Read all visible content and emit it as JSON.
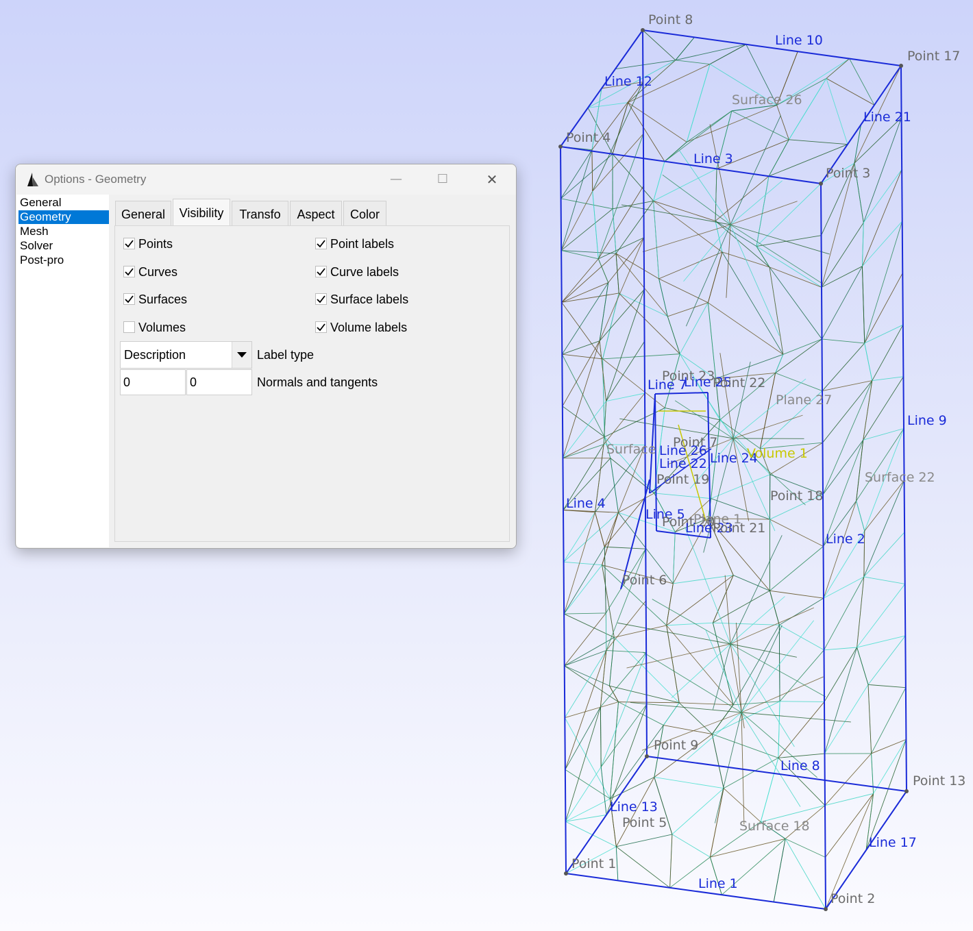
{
  "window": {
    "title": "Options - Geometry",
    "minimize": "—",
    "maximize": "☐",
    "close": "✕"
  },
  "sidebar": {
    "items": [
      {
        "label": "General",
        "selected": false
      },
      {
        "label": "Geometry",
        "selected": true
      },
      {
        "label": "Mesh",
        "selected": false
      },
      {
        "label": "Solver",
        "selected": false
      },
      {
        "label": "Post-pro",
        "selected": false
      }
    ]
  },
  "tabs": [
    {
      "label": "General",
      "active": false
    },
    {
      "label": "Visibility",
      "active": true
    },
    {
      "label": "Transfo",
      "active": false
    },
    {
      "label": "Aspect",
      "active": false
    },
    {
      "label": "Color",
      "active": false
    }
  ],
  "visibility": {
    "checkboxes": [
      {
        "label": "Points",
        "checked": true
      },
      {
        "label": "Point labels",
        "checked": true
      },
      {
        "label": "Curves",
        "checked": true
      },
      {
        "label": "Curve labels",
        "checked": true
      },
      {
        "label": "Surfaces",
        "checked": true
      },
      {
        "label": "Surface labels",
        "checked": true
      },
      {
        "label": "Volumes",
        "checked": false
      },
      {
        "label": "Volume labels",
        "checked": true
      }
    ],
    "label_type": {
      "value": "Description",
      "label": "Label type"
    },
    "normals": {
      "value1": "0",
      "value2": "0",
      "label": "Normals and tangents"
    }
  },
  "scene": {
    "colors": {
      "line": "#1a2bd8",
      "point": "#6b6b6b",
      "surface": "#8a8a8a",
      "volume": "#c8c800"
    },
    "labels": [
      {
        "text": "Point 8",
        "kind": "point"
      },
      {
        "text": "Line 10",
        "kind": "line"
      },
      {
        "text": "Point 17",
        "kind": "point"
      },
      {
        "text": "Line 12",
        "kind": "line"
      },
      {
        "text": "Surface 26",
        "kind": "surface"
      },
      {
        "text": "Line 21",
        "kind": "line"
      },
      {
        "text": "Point 4",
        "kind": "point"
      },
      {
        "text": "Line 3",
        "kind": "line"
      },
      {
        "text": "Point 3",
        "kind": "point"
      },
      {
        "text": "Point 23",
        "kind": "point"
      },
      {
        "text": "Line 7",
        "kind": "line"
      },
      {
        "text": "Line 25",
        "kind": "line"
      },
      {
        "text": "Point 22",
        "kind": "point"
      },
      {
        "text": "Plane 27",
        "kind": "surface"
      },
      {
        "text": "Line 9",
        "kind": "line"
      },
      {
        "text": "Point 7",
        "kind": "point"
      },
      {
        "text": "Surface",
        "kind": "surface"
      },
      {
        "text": "Line 26",
        "kind": "line"
      },
      {
        "text": "Line 24",
        "kind": "line"
      },
      {
        "text": "Volume 1",
        "kind": "volume"
      },
      {
        "text": "Line 22",
        "kind": "line"
      },
      {
        "text": "Point 19",
        "kind": "point"
      },
      {
        "text": "Surface 22",
        "kind": "surface"
      },
      {
        "text": "Point 18",
        "kind": "point"
      },
      {
        "text": "Line 4",
        "kind": "line"
      },
      {
        "text": "Line 5",
        "kind": "line"
      },
      {
        "text": "Point 20",
        "kind": "point"
      },
      {
        "text": "Plane 1",
        "kind": "surface"
      },
      {
        "text": "Line 23",
        "kind": "line"
      },
      {
        "text": "Point 21",
        "kind": "point"
      },
      {
        "text": "Line 2",
        "kind": "line"
      },
      {
        "text": "Point 6",
        "kind": "point"
      },
      {
        "text": "Point 9",
        "kind": "point"
      },
      {
        "text": "Line 8",
        "kind": "line"
      },
      {
        "text": "Point 13",
        "kind": "point"
      },
      {
        "text": "Line 13",
        "kind": "line"
      },
      {
        "text": "Point 5",
        "kind": "point"
      },
      {
        "text": "Surface 18",
        "kind": "surface"
      },
      {
        "text": "Line 17",
        "kind": "line"
      },
      {
        "text": "Point 1",
        "kind": "point"
      },
      {
        "text": "Line 1",
        "kind": "line"
      },
      {
        "text": "Point 2",
        "kind": "point"
      }
    ]
  }
}
